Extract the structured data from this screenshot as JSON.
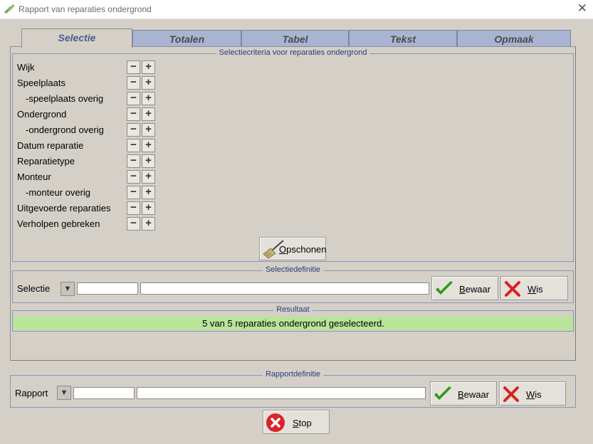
{
  "window": {
    "title": "Rapport van reparaties ondergrond",
    "close_glyph": "✕"
  },
  "tabs": [
    {
      "label": "Selectie",
      "active": true
    },
    {
      "label": "Totalen",
      "active": false
    },
    {
      "label": "Tabel",
      "active": false
    },
    {
      "label": "Tekst",
      "active": false
    },
    {
      "label": "Opmaak",
      "active": false
    }
  ],
  "criteria": {
    "legend": "Selectiecriteria voor reparaties ondergrond",
    "items": [
      "Wijk",
      "Speelplaats",
      "-speelplaats overig",
      "Ondergrond",
      "-ondergrond overig",
      "Datum reparatie",
      "Reparatietype",
      "Monteur",
      "-monteur overig",
      "Uitgevoerde reparaties",
      "Verholpen gebreken"
    ],
    "minus_glyph": "−",
    "plus_glyph": "+",
    "clean_button": {
      "hotkey": "O",
      "rest": "pschonen",
      "icon": "broom-icon"
    }
  },
  "selection_def": {
    "legend": "Selectiedefinitie",
    "label": "Selectie",
    "dropdown_glyph": "▼",
    "code_value": "",
    "name_value": "",
    "save": {
      "hotkey": "B",
      "rest": "ewaar",
      "icon": "checkmark-icon"
    },
    "clear": {
      "hotkey": "W",
      "rest": "is",
      "icon": "x-icon"
    }
  },
  "result": {
    "legend": "Resultaat",
    "text": "5 van 5 reparaties ondergrond geselecteerd."
  },
  "report_def": {
    "legend": "Rapportdefinitie",
    "label": "Rapport",
    "dropdown_glyph": "▼",
    "code_value": "",
    "name_value": "",
    "save": {
      "hotkey": "B",
      "rest": "ewaar",
      "icon": "checkmark-icon"
    },
    "clear": {
      "hotkey": "W",
      "rest": "is",
      "icon": "x-icon"
    }
  },
  "stop_button": {
    "hotkey": "S",
    "rest": "top",
    "icon": "stop-icon"
  },
  "colors": {
    "result_bg": "#b8e59a",
    "tab_inactive": "#a9b4d3",
    "check_green": "#2e9a1c",
    "x_red": "#d8221f",
    "stop_red": "#d9232a"
  }
}
